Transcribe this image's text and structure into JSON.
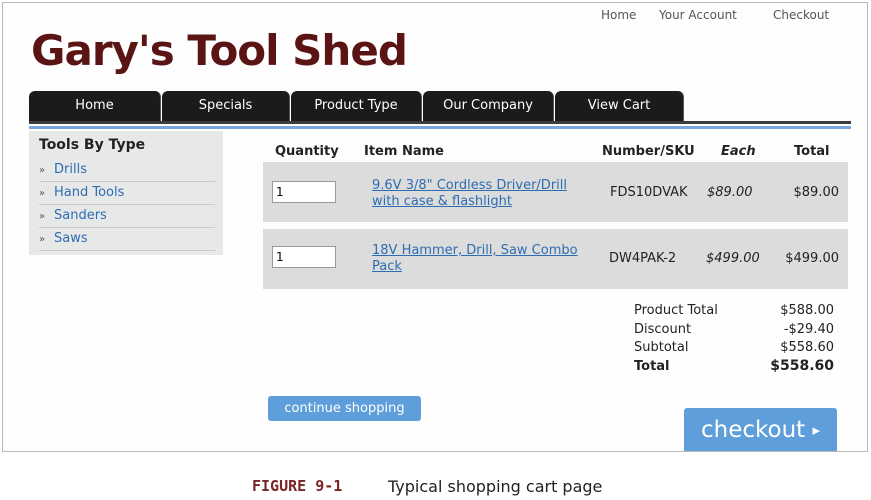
{
  "top_links": {
    "home": "Home",
    "account": "Your Account",
    "checkout": "Checkout"
  },
  "site_title": "Gary's Tool Shed",
  "nav_tabs": [
    "Home",
    "Specials",
    "Product Type",
    "Our Company",
    "View Cart"
  ],
  "sidebar": {
    "heading": "Tools By Type",
    "bullet": "»",
    "items": [
      "Drills",
      "Hand Tools",
      "Sanders",
      "Saws"
    ]
  },
  "cart": {
    "headers": {
      "quantity": "Quantity",
      "item_name": "Item Name",
      "sku": "Number/SKU",
      "each": "Each",
      "total": "Total"
    },
    "items": [
      {
        "qty": "1",
        "name": "9.6V 3/8\" Cordless Driver/Drill with case & flashlight",
        "sku": "FDS10DVAK",
        "each": "$89.00",
        "total": "$89.00"
      },
      {
        "qty": "1",
        "name": "18V Hammer, Drill, Saw Combo Pack",
        "sku": "DW4PAK-2",
        "each": "$499.00",
        "total": "$499.00"
      }
    ],
    "summary": {
      "product_total_label": "Product Total",
      "product_total": "$588.00",
      "discount_label": "Discount",
      "discount": "-$29.40",
      "subtotal_label": "Subtotal",
      "subtotal": "$558.60",
      "total_label": "Total",
      "total": "$558.60"
    }
  },
  "buttons": {
    "continue": "continue shopping",
    "checkout": "checkout",
    "checkout_arrow": "▸"
  },
  "caption": {
    "label": "FIGURE 9-1",
    "text": "Typical shopping cart page"
  },
  "colors": {
    "brand": "#5a1414",
    "nav_bg": "#1b1b1b",
    "link": "#2e6db1",
    "button": "#5e9fdb",
    "row_bg": "#dcdcdc",
    "sidebar_bg": "#e7e8e8",
    "caption_label": "#7a2424"
  }
}
